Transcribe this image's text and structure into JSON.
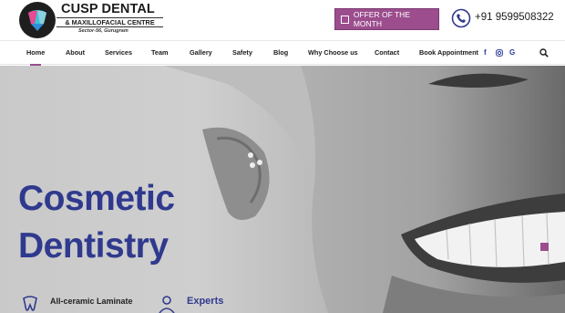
{
  "brand": {
    "name_line1": "CUSP DENTAL",
    "name_line2": "& MAXILLOFACIAL CENTRE",
    "location": "Sector-56, Gurugram"
  },
  "header": {
    "offer_label": "OFFER OF THE MONTH",
    "phone": "+91 9599508322"
  },
  "nav": {
    "items": [
      "Home",
      "About",
      "Services",
      "Team",
      "Gallery",
      "Safety",
      "Blog",
      "Why Choose us",
      "Contact",
      "Book Appointment"
    ],
    "active": "Home",
    "social": [
      "f",
      "instagram",
      "G"
    ]
  },
  "hero": {
    "title_line1": "Cosmetic",
    "title_line2": "Dentistry",
    "features": [
      {
        "label": "All-ceramic Laminate",
        "icon": "tooth-icon"
      },
      {
        "label": "Experts",
        "icon": "doctor-icon"
      }
    ]
  },
  "colors": {
    "accent": "#9b4d8d",
    "brand_blue": "#2f3a8e"
  }
}
